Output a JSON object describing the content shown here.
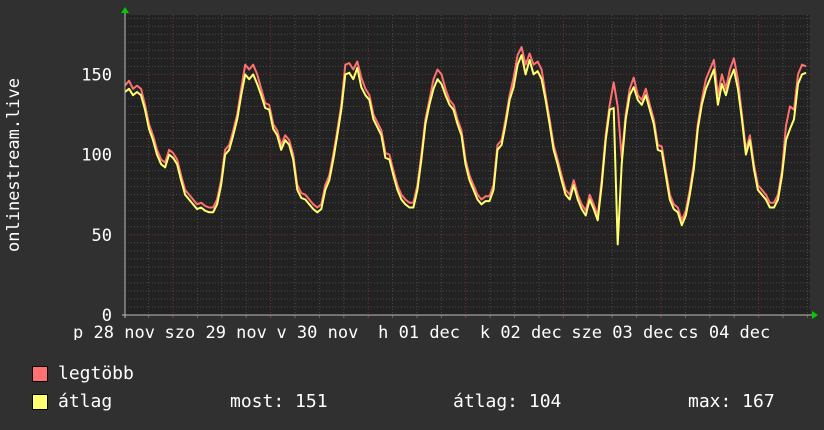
{
  "chart_data": {
    "type": "line",
    "ylabel": "onlinestream.live",
    "ylim": [
      0,
      187
    ],
    "y_ticks": [
      "0",
      "50",
      "100",
      "150"
    ],
    "x_tick_labels": [
      "p 28 nov",
      "szo 29 nov",
      "v 30 nov",
      "h 01 dec",
      "k 02 dec",
      "sze 03 dec",
      "cs 04 dec"
    ],
    "grid": true,
    "background": "#222222",
    "series": [
      {
        "name": "legtöbb",
        "color": "#ff7070",
        "values": [
          143,
          146,
          141,
          143,
          141,
          131,
          119,
          112,
          103,
          97,
          95,
          103,
          101,
          97,
          87,
          78,
          75,
          72,
          69,
          70,
          68,
          67,
          67,
          72,
          84,
          103,
          106,
          115,
          125,
          141,
          156,
          153,
          156,
          150,
          141,
          132,
          131,
          119,
          115,
          106,
          112,
          109,
          100,
          81,
          76,
          75,
          72,
          69,
          67,
          69,
          81,
          87,
          100,
          115,
          131,
          156,
          157,
          153,
          158,
          148,
          141,
          137,
          125,
          120,
          115,
          101,
          100,
          90,
          81,
          75,
          72,
          70,
          70,
          81,
          100,
          122,
          134,
          147,
          153,
          150,
          141,
          134,
          131,
          122,
          115,
          97,
          87,
          81,
          75,
          72,
          74,
          74,
          81,
          106,
          109,
          122,
          137,
          148,
          162,
          167,
          156,
          163,
          156,
          158,
          153,
          137,
          122,
          106,
          97,
          87,
          78,
          75,
          84,
          75,
          69,
          65,
          75,
          69,
          62,
          84,
          112,
          131,
          145,
          130,
          98,
          125,
          141,
          148,
          137,
          134,
          141,
          131,
          122,
          106,
          105,
          90,
          75,
          69,
          67,
          59,
          65,
          78,
          94,
          119,
          134,
          147,
          153,
          159,
          137,
          150,
          141,
          153,
          160,
          147,
          125,
          103,
          112,
          94,
          81,
          78,
          75,
          70,
          70,
          75,
          90,
          118,
          130,
          128,
          150,
          156,
          155
        ]
      },
      {
        "name": "átlag",
        "color": "#ffff70",
        "values": [
          139,
          141,
          137,
          139,
          137,
          128,
          116,
          109,
          100,
          94,
          92,
          100,
          98,
          94,
          84,
          75,
          72,
          69,
          66,
          67,
          65,
          64,
          64,
          69,
          81,
          100,
          103,
          112,
          122,
          137,
          150,
          147,
          150,
          144,
          137,
          129,
          128,
          116,
          112,
          103,
          109,
          106,
          97,
          78,
          73,
          72,
          69,
          66,
          64,
          66,
          78,
          84,
          97,
          112,
          128,
          150,
          151,
          147,
          154,
          142,
          137,
          134,
          122,
          117,
          112,
          98,
          97,
          87,
          78,
          72,
          69,
          67,
          67,
          78,
          97,
          119,
          131,
          141,
          147,
          144,
          137,
          131,
          128,
          119,
          112,
          94,
          84,
          78,
          72,
          69,
          71,
          71,
          78,
          103,
          106,
          119,
          134,
          142,
          156,
          162,
          150,
          159,
          150,
          152,
          147,
          134,
          119,
          103,
          94,
          84,
          75,
          72,
          81,
          72,
          66,
          62,
          72,
          66,
          59,
          81,
          109,
          128,
          129,
          44,
          94,
          122,
          137,
          142,
          134,
          131,
          137,
          128,
          119,
          103,
          102,
          87,
          72,
          66,
          64,
          56,
          62,
          75,
          91,
          116,
          131,
          141,
          147,
          153,
          131,
          144,
          137,
          147,
          153,
          141,
          122,
          100,
          109,
          91,
          78,
          75,
          72,
          67,
          67,
          72,
          87,
          109,
          116,
          122,
          144,
          150,
          151
        ]
      }
    ]
  },
  "legend": {
    "max_label": "legtöbb",
    "avg_label": "átlag",
    "now": "most: 151",
    "avg": "átlag: 104",
    "max": "max: 167"
  }
}
